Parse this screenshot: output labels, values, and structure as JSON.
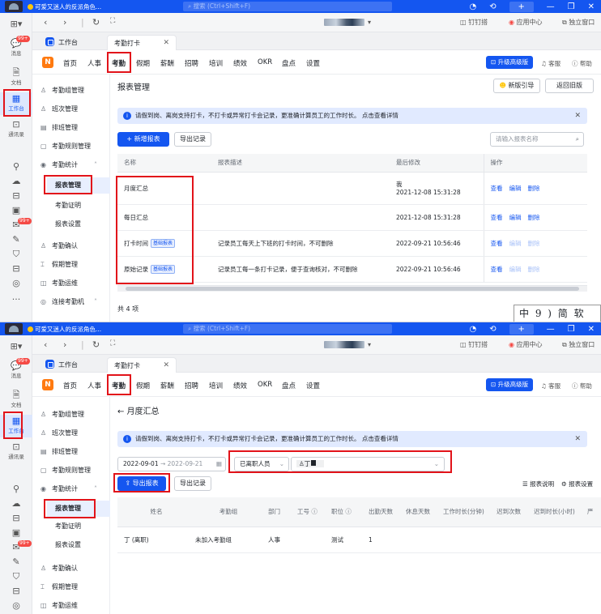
{
  "colors": {
    "accent": "#1456f0",
    "titlebar": "#1456f0",
    "highlight_box": "#e2131a",
    "badge": "#f54a45"
  },
  "titlebar": {
    "status": "可爱又迷人的反派角色...",
    "search_placeholder": "搜索 (Ctrl+Shift+F)"
  },
  "rail": {
    "messages_badge": "99+",
    "messages": "消息",
    "docs": "文档",
    "workbench": "工作台",
    "contacts": "通讯录",
    "badge2": "99+",
    "more": "···"
  },
  "nav": {
    "dingding": "钉钉搭",
    "app_center": "应用中心",
    "standalone": "独立窗口"
  },
  "tabs": [
    {
      "label": "工作台"
    },
    {
      "label": "考勤打卡"
    }
  ],
  "menu": {
    "logo": "N",
    "items": [
      "首页",
      "人事",
      "考勤",
      "假期",
      "薪酬",
      "招聘",
      "培训",
      "绩效",
      "OKR",
      "盘点",
      "设置"
    ],
    "upgrade": "升级高级版",
    "service": "客服",
    "help": "帮助"
  },
  "sidebar": {
    "group_mgmt": "考勤组管理",
    "shift_mgmt": "班次管理",
    "schedule_mgmt": "排班管理",
    "rule_mgmt": "考勤规则管理",
    "stats": "考勤统计",
    "report_mgmt": "报表管理",
    "proof": "考勤证明",
    "report_settings": "报表设置",
    "confirm": "考勤确认",
    "leave_mgmt": "假期管理",
    "ops": "考勤运维",
    "connect_machine": "连接考勤机"
  },
  "screen1": {
    "title": "报表管理",
    "new_guide": "新版引导",
    "back_old": "返回旧版",
    "notice": "请假到岗、离岗支持打卡，不打卡或异常打卡会记录，更准确计算员工的工作时长。 点击查看详情",
    "add_report": "+ 新增报表",
    "export_log": "导出记录",
    "search_placeholder": "请输入报表名称",
    "columns": [
      "名称",
      "报表描述",
      "最后修改",
      "操作"
    ],
    "rows": [
      {
        "name": "月度汇总",
        "tag": "",
        "desc": "",
        "modifier": "我",
        "modified": "2021-12-08 15:31:28",
        "actions_enabled": true
      },
      {
        "name": "每日汇总",
        "tag": "",
        "desc": "",
        "modifier": "",
        "modified": "2021-12-08 15:31:28",
        "actions_enabled": true
      },
      {
        "name": "打卡时间",
        "tag": "基础报表",
        "desc": "记录员工每天上下班的打卡时间，不可删除",
        "modifier": "",
        "modified": "2022-09-21 10:56:46",
        "actions_enabled": false
      },
      {
        "name": "原始记录",
        "tag": "基础报表",
        "desc": "记录员工每一条打卡记录，便于查询核对，不可删除",
        "modifier": "",
        "modified": "2022-09-21 10:56:46",
        "actions_enabled": false
      }
    ],
    "actions": [
      "查看",
      "编辑",
      "删除"
    ],
    "total": "共 4 项",
    "watermark": "中 9 ) 简 软"
  },
  "screen2": {
    "back_title": "← 月度汇总",
    "notice": "请假到岗、离岗支持打卡，不打卡或异常打卡会记录，更准确计算员工的工作时长。 点击查看详情",
    "date_from": "2022-09-01",
    "date_to": "→ 2022-09-21",
    "status_filter": "已离职人员",
    "person": "丁",
    "export_report": "导出报表",
    "export_log": "导出记录",
    "report_desc": "报表说明",
    "report_settings": "报表设置",
    "columns": [
      "姓名",
      "考勤组",
      "部门",
      "工号 ⓘ",
      "职位 ⓘ",
      "出勤天数",
      "休息天数",
      "工作时长(分钟)",
      "迟到次数",
      "迟到时长(小时)",
      "严"
    ],
    "rows": [
      {
        "name": "丁    (离职)",
        "group": "未加入考勤组",
        "dept": "人事",
        "emp_id": "",
        "position": "测试",
        "attend_days": "1",
        "rest_days": "",
        "work_minutes": "",
        "late_count": "",
        "late_hours": ""
      }
    ]
  }
}
